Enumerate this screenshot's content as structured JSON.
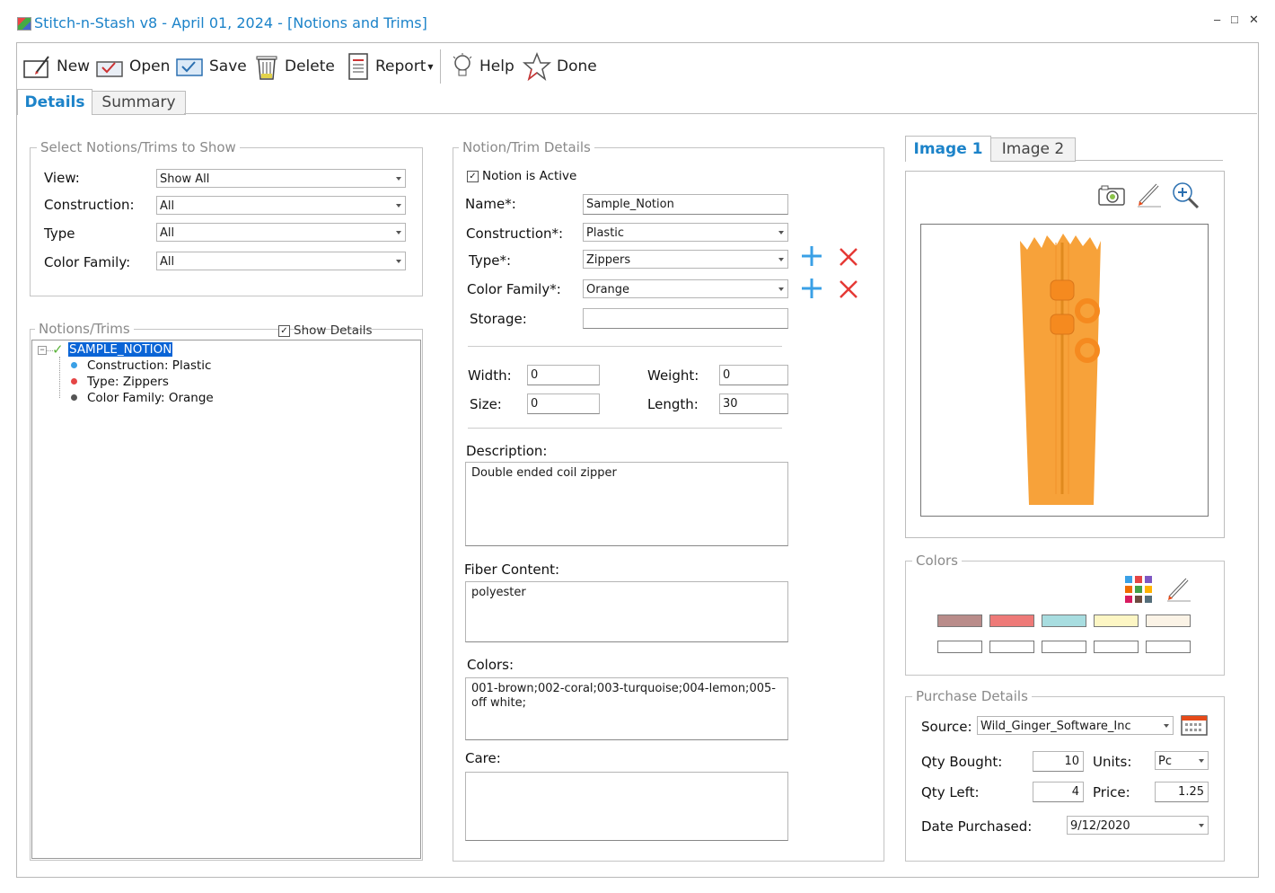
{
  "window": {
    "title": "Stitch-n-Stash v8 - April 01, 2024 - [Notions and Trims]",
    "minimize": "‒",
    "maximize": "□",
    "close": "✕"
  },
  "toolbar": {
    "new": "New",
    "open": "Open",
    "save": "Save",
    "delete": "Delete",
    "report": "Report",
    "help": "Help",
    "done": "Done"
  },
  "tabs": {
    "details": "Details",
    "summary": "Summary"
  },
  "filter": {
    "title": "Select Notions/Trims to Show",
    "view_label": "View:",
    "view_value": "Show All",
    "construction_label": "Construction:",
    "construction_value": "All",
    "type_label": "Type",
    "type_value": "All",
    "color_family_label": "Color Family:",
    "color_family_value": "All"
  },
  "tree": {
    "title": "Notions/Trims",
    "show_details": "Show Details",
    "root": "SAMPLE_NOTION",
    "children": [
      "Construction: Plastic",
      "Type: Zippers",
      "Color Family: Orange"
    ],
    "child_dot_colors": [
      "#3aa0e6",
      "#e54545",
      "#555555"
    ]
  },
  "details": {
    "title": "Notion/Trim Details",
    "active_label": "Notion is Active",
    "name_label": "Name*:",
    "name_value": "Sample_Notion",
    "construction_label": "Construction*:",
    "construction_value": "Plastic",
    "type_label": "Type*:",
    "type_value": "Zippers",
    "color_family_label": "Color Family*:",
    "color_family_value": "Orange",
    "storage_label": "Storage:",
    "storage_value": "",
    "width_label": "Width:",
    "width_value": "0",
    "weight_label": "Weight:",
    "weight_value": "0",
    "size_label": "Size:",
    "size_value": "0",
    "length_label": "Length:",
    "length_value": "30",
    "description_label": "Description:",
    "description_value": "Double ended coil zipper",
    "fiber_label": "Fiber Content:",
    "fiber_value": "polyester",
    "colors_label": "Colors:",
    "colors_value": "001-brown;002-coral;003-turquoise;004-lemon;005-off white;",
    "care_label": "Care:",
    "care_value": ""
  },
  "image": {
    "tab1": "Image 1",
    "tab2": "Image 2",
    "zipper_color": "#f7a23a"
  },
  "colors_panel": {
    "title": "Colors",
    "swatches": [
      "#b98c8a",
      "#ee7a78",
      "#a8dde0",
      "#fdf6c4",
      "#fbf3e6",
      "#ffffff",
      "#ffffff",
      "#ffffff",
      "#ffffff",
      "#ffffff"
    ]
  },
  "purchase": {
    "title": "Purchase Details",
    "source_label": "Source:",
    "source_value": "Wild_Ginger_Software_Inc",
    "qty_bought_label": "Qty Bought:",
    "qty_bought_value": "10",
    "units_label": "Units:",
    "units_value": "Pc",
    "qty_left_label": "Qty Left:",
    "qty_left_value": "4",
    "price_label": "Price:",
    "price_value": "1.25",
    "date_label": "Date Purchased:",
    "date_value": "9/12/2020"
  },
  "accent_color": "#1c83c9"
}
